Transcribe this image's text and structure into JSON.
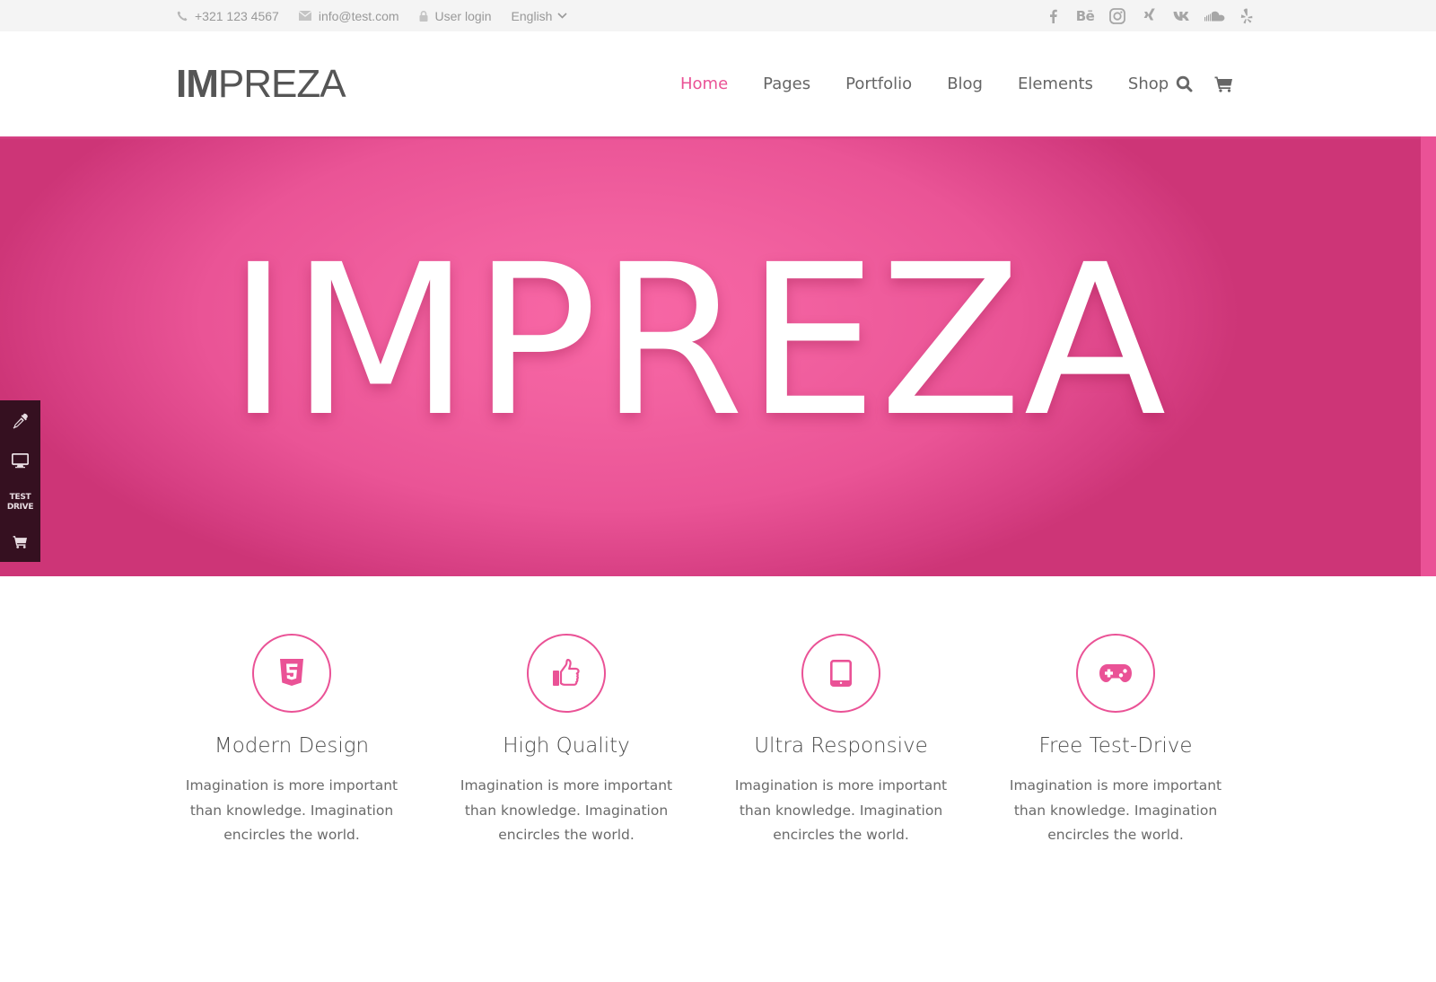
{
  "topbar": {
    "phone": "+321 123 4567",
    "email": "info@test.com",
    "login": "User login",
    "language": "English",
    "socials": [
      {
        "name": "facebook",
        "icon": "facebook-icon"
      },
      {
        "name": "behance",
        "icon": "behance-icon"
      },
      {
        "name": "instagram",
        "icon": "instagram-icon"
      },
      {
        "name": "xing",
        "icon": "xing-icon"
      },
      {
        "name": "vk",
        "icon": "vk-icon"
      },
      {
        "name": "soundcloud",
        "icon": "soundcloud-icon"
      },
      {
        "name": "yelp",
        "icon": "yelp-icon"
      }
    ]
  },
  "header": {
    "logo_bold": "IM",
    "logo_rest": "PREZA",
    "nav": [
      {
        "label": "Home",
        "active": true
      },
      {
        "label": "Pages",
        "active": false
      },
      {
        "label": "Portfolio",
        "active": false
      },
      {
        "label": "Blog",
        "active": false
      },
      {
        "label": "Elements",
        "active": false
      },
      {
        "label": "Shop",
        "active": false
      }
    ],
    "icons": [
      "search-icon",
      "cart-icon"
    ]
  },
  "hero": {
    "title": "IMPREZA"
  },
  "sidepanel": {
    "items": [
      "eyedropper-icon",
      "monitor-icon",
      "test-drive",
      "cart-icon"
    ],
    "test_drive_line1": "TEST",
    "test_drive_line2": "DRIVE"
  },
  "features": [
    {
      "icon": "html5-icon",
      "title": "Modern Design",
      "desc": "Imagination is more important than knowledge. Imagination encircles the world."
    },
    {
      "icon": "thumbs-up-icon",
      "title": "High Quality",
      "desc": "Imagination is more important than knowledge. Imagination encircles the world."
    },
    {
      "icon": "tablet-icon",
      "title": "Ultra Responsive",
      "desc": "Imagination is more important than knowledge. Imagination encircles the world."
    },
    {
      "icon": "gamepad-icon",
      "title": "Free Test-Drive",
      "desc": "Imagination is more important than knowledge. Imagination encircles the world."
    }
  ],
  "colors": {
    "accent": "#ea5296",
    "hero_light": "#f867a5",
    "hero_dark": "#cd3577",
    "topbar_bg": "#f4f4f4",
    "sidepanel_bg": "#351020",
    "text": "#666666"
  }
}
